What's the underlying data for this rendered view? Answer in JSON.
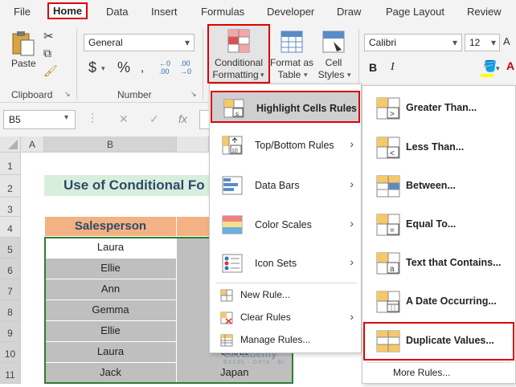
{
  "tabs": [
    "File",
    "Home",
    "Data",
    "Insert",
    "Formulas",
    "Developer",
    "Draw",
    "Page Layout",
    "Review"
  ],
  "ribbon": {
    "paste_label": "Paste",
    "clipboard_label": "Clipboard",
    "number_format": "General",
    "number_label": "Number",
    "currency_glyph": "$",
    "percent_glyph": "%",
    "cond_format_line1": "Conditional",
    "cond_format_line2": "Formatting",
    "format_table_line1": "Format as",
    "format_table_line2": "Table",
    "cell_styles_line1": "Cell",
    "cell_styles_line2": "Styles",
    "font_name": "Calibri",
    "font_size": "12",
    "bold_glyph": "B",
    "italic_glyph": "I"
  },
  "formula_bar": {
    "name_box": "B5",
    "fx": "fx"
  },
  "grid": {
    "columns": [
      "A",
      "B"
    ],
    "rows": [
      "1",
      "2",
      "3",
      "4",
      "5",
      "6",
      "7",
      "8",
      "9",
      "10",
      "11"
    ],
    "title": "Use of Conditional Fo",
    "header": "Salesperson",
    "names": [
      "Laura",
      "Ellie",
      "Ann",
      "Gemma",
      "Ellie",
      "Laura",
      "Jack"
    ],
    "col_c_visible": [
      "",
      "",
      "",
      "",
      "",
      "China",
      "Japan"
    ]
  },
  "menu": {
    "items": [
      {
        "label": "Highlight Cells Rules",
        "icon": "highlight-cells-icon"
      },
      {
        "label": "Top/Bottom Rules",
        "icon": "top-bottom-icon"
      },
      {
        "label": "Data Bars",
        "icon": "data-bars-icon"
      },
      {
        "label": "Color Scales",
        "icon": "color-scales-icon"
      },
      {
        "label": "Icon Sets",
        "icon": "icon-sets-icon"
      }
    ],
    "small": [
      "New Rule...",
      "Clear Rules",
      "Manage Rules..."
    ]
  },
  "submenu": {
    "items": [
      "Greater Than...",
      "Less Than...",
      "Between...",
      "Equal To...",
      "Text that Contains...",
      "A Date Occurring...",
      "Duplicate Values..."
    ],
    "more": "More Rules..."
  },
  "watermark": {
    "brand": "exceldemy",
    "tagline": "EXCEL · DATA · BI"
  },
  "colors": {
    "accent_red": "#dd0000",
    "title_fill": "#d8eedd",
    "header_fill": "#f4b183",
    "name_fill": "#bfbfbf",
    "green_border": "#2e7d32"
  }
}
